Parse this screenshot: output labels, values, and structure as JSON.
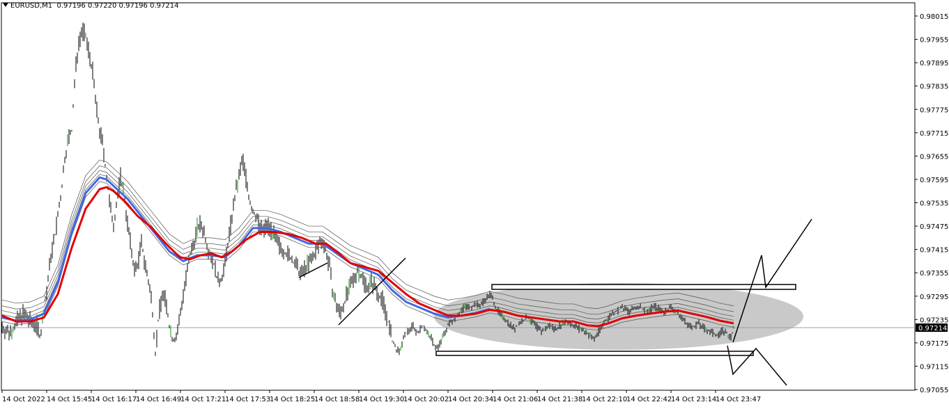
{
  "header": {
    "symbol_timeframe": "EURUSD,M1",
    "ohlc": "0.97196 0.97220 0.97196 0.97214"
  },
  "current_price_label": "0.97214",
  "colors": {
    "background": "#ffffff",
    "bars": "#000000",
    "up_bars_accent": "#00a000",
    "ma_red": "#e00000",
    "ma_blue": "#4169e1",
    "ma_thin": "#505050",
    "price_line": "#8aa0c8",
    "ellipse": "#c0c0c0"
  },
  "chart_data": {
    "type": "candlestick",
    "title": "EURUSD,M1",
    "y_ticks": [
      "0.98015",
      "0.97955",
      "0.97895",
      "0.97835",
      "0.97775",
      "0.97715",
      "0.97655",
      "0.97595",
      "0.97535",
      "0.97475",
      "0.97415",
      "0.97355",
      "0.97295",
      "0.97235",
      "0.97175",
      "0.97115",
      "0.97055"
    ],
    "y_tick_values": [
      0.98015,
      0.97955,
      0.97895,
      0.97835,
      0.97775,
      0.97715,
      0.97655,
      0.97595,
      0.97535,
      0.97475,
      0.97415,
      0.97355,
      0.97295,
      0.97235,
      0.97175,
      0.97115,
      0.97055
    ],
    "ylim": [
      0.9705,
      0.98035
    ],
    "x_ticks": [
      "14 Oct 2022",
      "14 Oct 15:45",
      "14 Oct 16:17",
      "14 Oct 16:49",
      "14 Oct 17:21",
      "14 Oct 17:53",
      "14 Oct 18:25",
      "14 Oct 18:58",
      "14 Oct 19:30",
      "14 Oct 20:02",
      "14 Oct 20:34",
      "14 Oct 21:06",
      "14 Oct 21:38",
      "14 Oct 22:10",
      "14 Oct 22:42",
      "14 Oct 23:14",
      "14 Oct 23:47"
    ],
    "current_price": 0.97214,
    "price_path": [
      [
        0,
        0.97215
      ],
      [
        10,
        0.972
      ],
      [
        20,
        0.97225
      ],
      [
        30,
        0.9725
      ],
      [
        40,
        0.9723
      ],
      [
        50,
        0.9722
      ],
      [
        55,
        0.9719
      ],
      [
        60,
        0.9726
      ],
      [
        65,
        0.9732
      ],
      [
        70,
        0.974
      ],
      [
        75,
        0.9744
      ],
      [
        80,
        0.975
      ],
      [
        85,
        0.9756
      ],
      [
        90,
        0.9765
      ],
      [
        95,
        0.977
      ],
      [
        100,
        0.9772
      ],
      [
        105,
        0.9787
      ],
      [
        110,
        0.9795
      ],
      [
        115,
        0.9798
      ],
      [
        120,
        0.9796
      ],
      [
        125,
        0.9792
      ],
      [
        130,
        0.9787
      ],
      [
        135,
        0.9778
      ],
      [
        140,
        0.9772
      ],
      [
        145,
        0.9768
      ],
      [
        150,
        0.976
      ],
      [
        155,
        0.9752
      ],
      [
        160,
        0.9748
      ],
      [
        165,
        0.9754
      ],
      [
        170,
        0.976
      ],
      [
        175,
        0.9756
      ],
      [
        180,
        0.9748
      ],
      [
        185,
        0.9742
      ],
      [
        190,
        0.9736
      ],
      [
        195,
        0.9738
      ],
      [
        200,
        0.9743
      ],
      [
        205,
        0.9738
      ],
      [
        210,
        0.9733
      ],
      [
        215,
        0.9728
      ],
      [
        220,
        0.9715
      ],
      [
        225,
        0.9725
      ],
      [
        230,
        0.973
      ],
      [
        235,
        0.9728
      ],
      [
        240,
        0.9722
      ],
      [
        245,
        0.9718
      ],
      [
        250,
        0.9719
      ],
      [
        255,
        0.9724
      ],
      [
        260,
        0.973
      ],
      [
        265,
        0.9735
      ],
      [
        270,
        0.974
      ],
      [
        275,
        0.9743
      ],
      [
        280,
        0.9747
      ],
      [
        285,
        0.9748
      ],
      [
        290,
        0.9746
      ],
      [
        295,
        0.9742
      ],
      [
        300,
        0.974
      ],
      [
        305,
        0.9737
      ],
      [
        310,
        0.9733
      ],
      [
        315,
        0.9734
      ],
      [
        320,
        0.9738
      ],
      [
        325,
        0.9744
      ],
      [
        330,
        0.975
      ],
      [
        335,
        0.9756
      ],
      [
        340,
        0.976
      ],
      [
        345,
        0.9765
      ],
      [
        350,
        0.976
      ],
      [
        355,
        0.9754
      ],
      [
        360,
        0.9751
      ],
      [
        365,
        0.975
      ],
      [
        370,
        0.9747
      ],
      [
        375,
        0.9746
      ],
      [
        380,
        0.9748
      ],
      [
        385,
        0.9747
      ],
      [
        390,
        0.9745
      ],
      [
        395,
        0.9743
      ],
      [
        400,
        0.9742
      ],
      [
        405,
        0.9741
      ],
      [
        410,
        0.974
      ],
      [
        415,
        0.9739
      ],
      [
        420,
        0.9738
      ],
      [
        425,
        0.9736
      ],
      [
        430,
        0.9735
      ],
      [
        435,
        0.9737
      ],
      [
        440,
        0.9738
      ],
      [
        445,
        0.9739
      ],
      [
        450,
        0.9741
      ],
      [
        455,
        0.9743
      ],
      [
        460,
        0.9744
      ],
      [
        465,
        0.9741
      ],
      [
        470,
        0.9737
      ],
      [
        475,
        0.973
      ],
      [
        480,
        0.9727
      ],
      [
        485,
        0.9725
      ],
      [
        490,
        0.9727
      ],
      [
        495,
        0.973
      ],
      [
        500,
        0.9732
      ],
      [
        505,
        0.9734
      ],
      [
        510,
        0.9736
      ],
      [
        515,
        0.9735
      ],
      [
        520,
        0.9733
      ],
      [
        525,
        0.9732
      ],
      [
        530,
        0.9733
      ],
      [
        535,
        0.9732
      ],
      [
        540,
        0.973
      ],
      [
        545,
        0.9729
      ],
      [
        550,
        0.9726
      ],
      [
        555,
        0.9722
      ],
      [
        560,
        0.9718
      ],
      [
        565,
        0.9716
      ],
      [
        570,
        0.9715
      ],
      [
        575,
        0.9718
      ],
      [
        580,
        0.972
      ],
      [
        585,
        0.9721
      ],
      [
        590,
        0.9722
      ],
      [
        595,
        0.972
      ],
      [
        600,
        0.9721
      ],
      [
        605,
        0.9722
      ],
      [
        610,
        0.972
      ],
      [
        615,
        0.9719
      ],
      [
        620,
        0.9717
      ],
      [
        625,
        0.9716
      ],
      [
        630,
        0.9718
      ],
      [
        635,
        0.972
      ],
      [
        640,
        0.9722
      ],
      [
        645,
        0.9723
      ],
      [
        650,
        0.9724
      ],
      [
        655,
        0.9725
      ],
      [
        660,
        0.9726
      ],
      [
        665,
        0.9727
      ],
      [
        670,
        0.97265
      ],
      [
        675,
        0.9727
      ],
      [
        680,
        0.97275
      ],
      [
        685,
        0.9727
      ],
      [
        690,
        0.9728
      ],
      [
        695,
        0.9729
      ],
      [
        700,
        0.973
      ],
      [
        705,
        0.97285
      ],
      [
        710,
        0.9726
      ],
      [
        715,
        0.9725
      ],
      [
        720,
        0.9724
      ],
      [
        725,
        0.9723
      ],
      [
        730,
        0.9722
      ],
      [
        735,
        0.9721
      ],
      [
        740,
        0.9722
      ],
      [
        745,
        0.9723
      ],
      [
        750,
        0.97235
      ],
      [
        755,
        0.9724
      ],
      [
        760,
        0.9723
      ],
      [
        765,
        0.9722
      ],
      [
        770,
        0.9721
      ],
      [
        775,
        0.97205
      ],
      [
        780,
        0.9721
      ],
      [
        785,
        0.9722
      ],
      [
        790,
        0.97215
      ],
      [
        795,
        0.9721
      ],
      [
        800,
        0.9722
      ],
      [
        805,
        0.97225
      ],
      [
        810,
        0.9723
      ],
      [
        815,
        0.97225
      ],
      [
        820,
        0.9722
      ],
      [
        825,
        0.97215
      ],
      [
        830,
        0.9721
      ],
      [
        835,
        0.97205
      ],
      [
        840,
        0.972
      ],
      [
        845,
        0.9719
      ],
      [
        850,
        0.97185
      ],
      [
        855,
        0.972
      ],
      [
        860,
        0.97215
      ],
      [
        865,
        0.9723
      ],
      [
        870,
        0.9724
      ],
      [
        875,
        0.9725
      ],
      [
        880,
        0.97255
      ],
      [
        885,
        0.9726
      ],
      [
        890,
        0.97265
      ],
      [
        895,
        0.9726
      ],
      [
        900,
        0.97255
      ],
      [
        905,
        0.9726
      ],
      [
        910,
        0.97265
      ],
      [
        915,
        0.9727
      ],
      [
        920,
        0.9726
      ],
      [
        925,
        0.97255
      ],
      [
        930,
        0.9726
      ],
      [
        935,
        0.9727
      ],
      [
        940,
        0.97265
      ],
      [
        945,
        0.9726
      ],
      [
        950,
        0.97255
      ],
      [
        955,
        0.9726
      ],
      [
        960,
        0.97265
      ],
      [
        965,
        0.9726
      ],
      [
        970,
        0.9725
      ],
      [
        975,
        0.9724
      ],
      [
        980,
        0.9723
      ],
      [
        985,
        0.9722
      ],
      [
        990,
        0.97215
      ],
      [
        995,
        0.9722
      ],
      [
        1000,
        0.97225
      ],
      [
        1005,
        0.97215
      ],
      [
        1010,
        0.9721
      ],
      [
        1015,
        0.97205
      ],
      [
        1020,
        0.972
      ],
      [
        1025,
        0.97195
      ],
      [
        1030,
        0.972
      ],
      [
        1035,
        0.97205
      ],
      [
        1040,
        0.972
      ],
      [
        1045,
        0.97185
      ],
      [
        1050,
        0.97214
      ]
    ],
    "ma_red": [
      [
        0,
        0.97245
      ],
      [
        20,
        0.9723
      ],
      [
        40,
        0.9723
      ],
      [
        60,
        0.9724
      ],
      [
        80,
        0.973
      ],
      [
        100,
        0.9742
      ],
      [
        120,
        0.9752
      ],
      [
        140,
        0.9757
      ],
      [
        150,
        0.97575
      ],
      [
        160,
        0.97565
      ],
      [
        175,
        0.9754
      ],
      [
        195,
        0.975
      ],
      [
        215,
        0.9747
      ],
      [
        235,
        0.9743
      ],
      [
        255,
        0.97395
      ],
      [
        270,
        0.9739
      ],
      [
        285,
        0.974
      ],
      [
        300,
        0.97405
      ],
      [
        315,
        0.97395
      ],
      [
        330,
        0.9741
      ],
      [
        350,
        0.9744
      ],
      [
        370,
        0.9746
      ],
      [
        390,
        0.9746
      ],
      [
        410,
        0.97455
      ],
      [
        430,
        0.97445
      ],
      [
        450,
        0.9743
      ],
      [
        465,
        0.9743
      ],
      [
        480,
        0.9741
      ],
      [
        500,
        0.9738
      ],
      [
        520,
        0.9737
      ],
      [
        540,
        0.9736
      ],
      [
        560,
        0.9733
      ],
      [
        580,
        0.973
      ],
      [
        600,
        0.97275
      ],
      [
        620,
        0.9726
      ],
      [
        640,
        0.97245
      ],
      [
        660,
        0.97245
      ],
      [
        680,
        0.9725
      ],
      [
        700,
        0.9726
      ],
      [
        720,
        0.97255
      ],
      [
        740,
        0.97245
      ],
      [
        760,
        0.9724
      ],
      [
        780,
        0.97235
      ],
      [
        800,
        0.9723
      ],
      [
        820,
        0.9723
      ],
      [
        840,
        0.9722
      ],
      [
        855,
        0.97218
      ],
      [
        870,
        0.97225
      ],
      [
        890,
        0.97238
      ],
      [
        910,
        0.97245
      ],
      [
        930,
        0.9725
      ],
      [
        950,
        0.97255
      ],
      [
        970,
        0.97258
      ],
      [
        990,
        0.9725
      ],
      [
        1010,
        0.97242
      ],
      [
        1030,
        0.97232
      ],
      [
        1050,
        0.97225
      ]
    ],
    "ma_blue": [
      [
        0,
        0.9724
      ],
      [
        20,
        0.97232
      ],
      [
        40,
        0.97235
      ],
      [
        60,
        0.9725
      ],
      [
        80,
        0.9733
      ],
      [
        100,
        0.9746
      ],
      [
        120,
        0.9756
      ],
      [
        140,
        0.976
      ],
      [
        150,
        0.97595
      ],
      [
        165,
        0.9757
      ],
      [
        180,
        0.97545
      ],
      [
        200,
        0.975
      ],
      [
        220,
        0.97455
      ],
      [
        240,
        0.9741
      ],
      [
        260,
        0.97385
      ],
      [
        280,
        0.974
      ],
      [
        300,
        0.974
      ],
      [
        320,
        0.97395
      ],
      [
        340,
        0.97425
      ],
      [
        360,
        0.9747
      ],
      [
        380,
        0.9747
      ],
      [
        400,
        0.9746
      ],
      [
        420,
        0.97445
      ],
      [
        440,
        0.9743
      ],
      [
        460,
        0.9743
      ],
      [
        480,
        0.97405
      ],
      [
        500,
        0.9738
      ],
      [
        520,
        0.97365
      ],
      [
        540,
        0.9735
      ],
      [
        560,
        0.9731
      ],
      [
        580,
        0.9728
      ],
      [
        600,
        0.97265
      ],
      [
        620,
        0.9725
      ],
      [
        640,
        0.9724
      ],
      [
        660,
        0.97245
      ],
      [
        680,
        0.97252
      ],
      [
        700,
        0.97262
      ]
    ],
    "annotations": [
      "horizontal rectangle at 0.97315",
      "horizontal rectangle at 0.97140",
      "grey ellipse range zone",
      "trend lines"
    ]
  }
}
